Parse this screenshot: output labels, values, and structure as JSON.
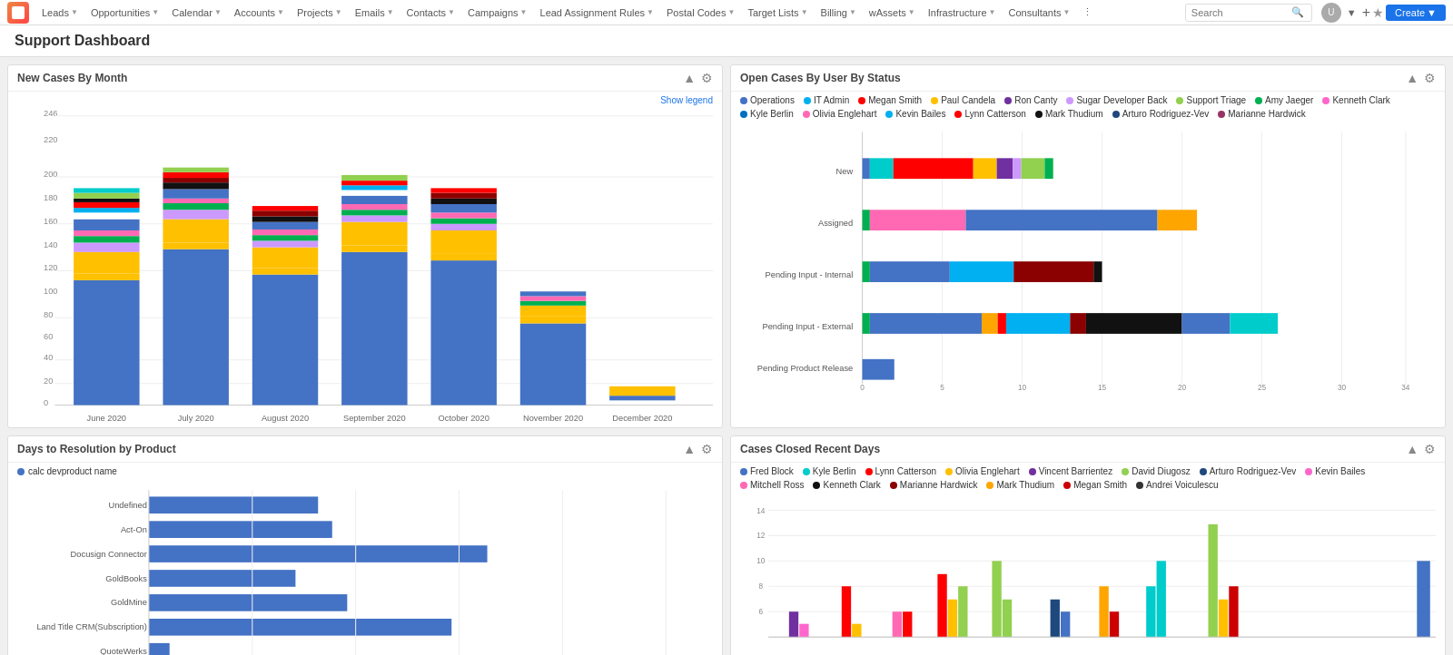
{
  "nav": {
    "items": [
      "Leads",
      "Opportunities",
      "Calendar",
      "Accounts",
      "Projects",
      "Emails",
      "Contacts",
      "Campaigns",
      "Lead Assignment Rules",
      "Postal Codes",
      "Target Lists",
      "Billing",
      "wAssets",
      "Infrastructure",
      "Consultants"
    ],
    "search_placeholder": "Search",
    "create_label": "Create"
  },
  "page": {
    "title": "Support Dashboard"
  },
  "panels": {
    "new_cases": {
      "title": "New Cases By Month",
      "show_legend": "Show legend"
    },
    "open_cases": {
      "title": "Open Cases By User By Status",
      "legend": [
        {
          "label": "Operations",
          "color": "#4472C4"
        },
        {
          "label": "IT Admin",
          "color": "#00B0F0"
        },
        {
          "label": "Megan Smith",
          "color": "#FF0000"
        },
        {
          "label": "Paul Candela",
          "color": "#FFC000"
        },
        {
          "label": "Ron Canty",
          "color": "#7030A0"
        },
        {
          "label": "Sugar Developer Back",
          "color": "#CC99FF"
        },
        {
          "label": "Support Triage",
          "color": "#92D050"
        },
        {
          "label": "Amy Jaeger",
          "color": "#00B050"
        },
        {
          "label": "Kenneth Clark",
          "color": "#FF66CC"
        },
        {
          "label": "Kyle Berlin",
          "color": "#0070C0"
        },
        {
          "label": "Olivia Englehart",
          "color": "#FF69B4"
        },
        {
          "label": "Kevin Bailes",
          "color": "#00B0F0"
        },
        {
          "label": "Lynn Catterson",
          "color": "#FF0000"
        },
        {
          "label": "Mark Thudium",
          "color": "#111111"
        },
        {
          "label": "Arturo Rodriguez-Vev",
          "color": "#1F497D"
        },
        {
          "label": "Marianne Hardwick",
          "color": "#993366"
        }
      ],
      "rows": [
        {
          "label": "New",
          "bars": [
            {
              "color": "#4472C4",
              "w": 0.5
            },
            {
              "color": "#00CCCC",
              "w": 1.5
            },
            {
              "color": "#FF0000",
              "w": 5
            },
            {
              "color": "#FFC000",
              "w": 1.5
            },
            {
              "color": "#7030A0",
              "w": 1
            },
            {
              "color": "#CC99FF",
              "w": 0.5
            },
            {
              "color": "#92D050",
              "w": 1.5
            },
            {
              "color": "#00B050",
              "w": 0.5
            }
          ]
        },
        {
          "label": "Assigned",
          "bars": [
            {
              "color": "#00B050",
              "w": 0.5
            },
            {
              "color": "#FF69B4",
              "w": 6
            },
            {
              "color": "#4472C4",
              "w": 12
            },
            {
              "color": "#FFA500",
              "w": 2.5
            }
          ]
        },
        {
          "label": "Pending Input - Internal",
          "bars": [
            {
              "color": "#00B050",
              "w": 0.5
            },
            {
              "color": "#4472C4",
              "w": 5
            },
            {
              "color": "#00B0F0",
              "w": 4
            },
            {
              "color": "#8B0000",
              "w": 5
            },
            {
              "color": "#111111",
              "w": 0.5
            }
          ]
        },
        {
          "label": "Pending Input - External",
          "bars": [
            {
              "color": "#00B050",
              "w": 0.5
            },
            {
              "color": "#4472C4",
              "w": 7
            },
            {
              "color": "#FFA500",
              "w": 1
            },
            {
              "color": "#FF0000",
              "w": 0.5
            },
            {
              "color": "#00B0F0",
              "w": 4
            },
            {
              "color": "#8B0000",
              "w": 1
            },
            {
              "color": "#111111",
              "w": 6
            },
            {
              "color": "#4472C4",
              "w": 3
            },
            {
              "color": "#00CCCC",
              "w": 3
            }
          ]
        },
        {
          "label": "Pending Product Release",
          "bars": [
            {
              "color": "#4472C4",
              "w": 2
            }
          ]
        }
      ]
    },
    "days_resolution": {
      "title": "Days to Resolution by Product",
      "legend_label": "calc devproduct name",
      "legend_color": "#4472C4",
      "rows": [
        {
          "label": "Undefined",
          "value": 3.2
        },
        {
          "label": "Act-On",
          "value": 3.5
        },
        {
          "label": "Docusign Connector",
          "value": 6.5
        },
        {
          "label": "GoldBooks",
          "value": 2.8
        },
        {
          "label": "GoldMine",
          "value": 3.8
        },
        {
          "label": "Land Title CRM(Subscription)",
          "value": 5.8
        },
        {
          "label": "QuoteWerks",
          "value": 0.4
        }
      ]
    },
    "cases_closed": {
      "title": "Cases Closed Recent Days",
      "legend": [
        {
          "label": "Fred Block",
          "color": "#4472C4"
        },
        {
          "label": "Kyle Berlin",
          "color": "#00CCCC"
        },
        {
          "label": "Lynn Catterson",
          "color": "#FF0000"
        },
        {
          "label": "Olivia Englehart",
          "color": "#FFC000"
        },
        {
          "label": "Vincent Barrientez",
          "color": "#7030A0"
        },
        {
          "label": "David Diugosz",
          "color": "#92D050"
        },
        {
          "label": "Arturo Rodriguez-Vev",
          "color": "#1F497D"
        },
        {
          "label": "Kevin Bailes",
          "color": "#FF66CC"
        },
        {
          "label": "Mitchell Ross",
          "color": "#FF69B4"
        },
        {
          "label": "Kenneth Clark",
          "color": "#111111"
        },
        {
          "label": "Marianne Hardwick",
          "color": "#8B0000"
        },
        {
          "label": "Mark Thudium",
          "color": "#FFA500"
        },
        {
          "label": "Megan Smith",
          "color": "#CC0000"
        },
        {
          "label": "Andrei Voiculescu",
          "color": "#333333"
        }
      ]
    }
  }
}
